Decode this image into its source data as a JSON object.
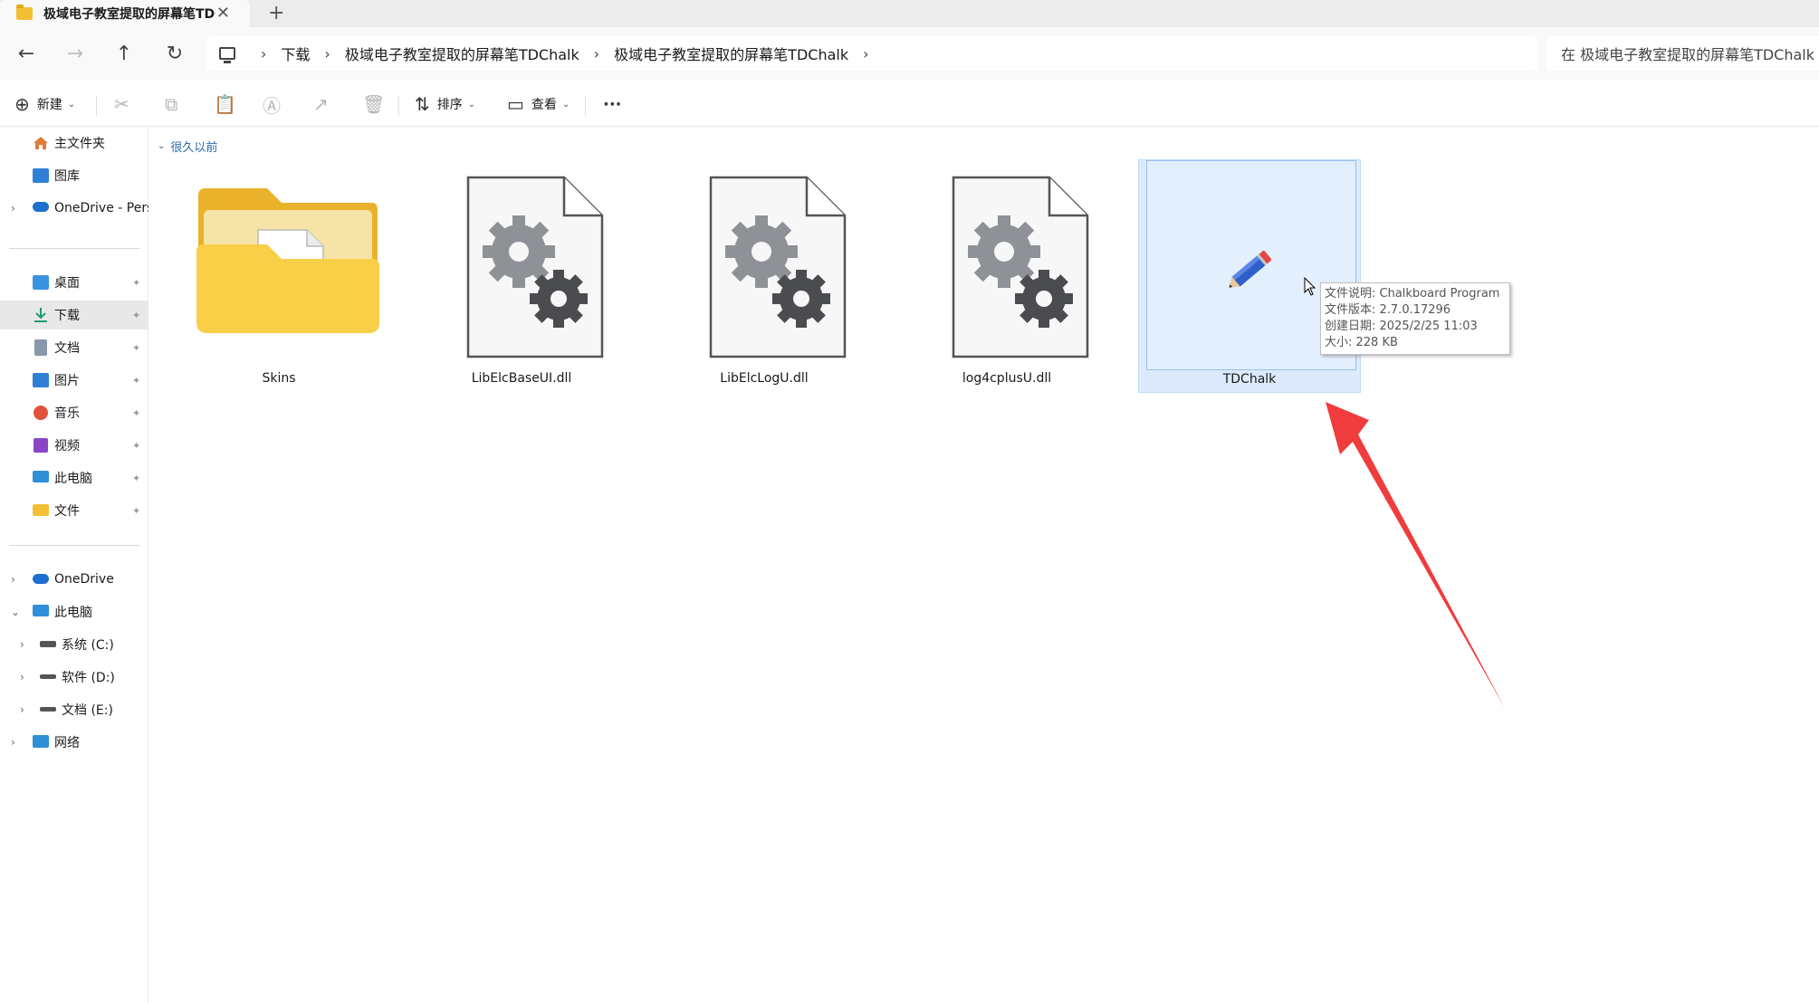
{
  "window": {
    "tab_title": "极域电子教室提取的屏幕笔TDC",
    "close_glyph": "✕",
    "new_tab_glyph": "+"
  },
  "nav": {
    "back_glyph": "←",
    "forward_glyph": "→",
    "up_glyph": "↑",
    "refresh_glyph": "↻"
  },
  "breadcrumb": {
    "separator": "›",
    "items": [
      "下载",
      "极域电子教室提取的屏幕笔TDChalk",
      "极域电子教室提取的屏幕笔TDChalk"
    ]
  },
  "search": {
    "placeholder": "在 极域电子教室提取的屏幕笔TDChalk 中搜索"
  },
  "toolbar": {
    "new_label": "新建",
    "sort_label": "排序",
    "view_label": "查看",
    "more_glyph": "···"
  },
  "sidebar": {
    "quick": [
      {
        "label": "主文件夹",
        "icon": "home-icon",
        "color": "#e07b39"
      },
      {
        "label": "图库",
        "icon": "gallery-icon",
        "color": "#2f7fd6"
      },
      {
        "label": "OneDrive - Pers",
        "icon": "cloud-icon",
        "color": "#1e6fd0"
      }
    ],
    "pinned": [
      {
        "label": "桌面",
        "icon": "desktop-icon",
        "color": "#3a93e0"
      },
      {
        "label": "下载",
        "icon": "download-icon",
        "color": "#1f9d6b"
      },
      {
        "label": "文档",
        "icon": "document-icon",
        "color": "#7a8a9c"
      },
      {
        "label": "图片",
        "icon": "picture-icon",
        "color": "#2f7fd6"
      },
      {
        "label": "音乐",
        "icon": "music-icon",
        "color": "#e0533a"
      },
      {
        "label": "视频",
        "icon": "video-icon",
        "color": "#8a45c7"
      },
      {
        "label": "此电脑",
        "icon": "computer-icon",
        "color": "#2f8fd8"
      },
      {
        "label": "文件",
        "icon": "folder-icon",
        "color": "#f3c035"
      }
    ],
    "tree": [
      {
        "label": "OneDrive",
        "icon": "cloud-icon",
        "color": "#1e6fd0"
      },
      {
        "label": "此电脑",
        "icon": "computer-icon",
        "color": "#2f8fd8"
      },
      {
        "label": "系统 (C:)",
        "icon": "drive-c-icon",
        "color": "#555555"
      },
      {
        "label": "软件 (D:)",
        "icon": "drive-icon",
        "color": "#555555"
      },
      {
        "label": "文档 (E:)",
        "icon": "drive-icon",
        "color": "#555555"
      },
      {
        "label": "网络",
        "icon": "network-icon",
        "color": "#2f8fd8"
      }
    ],
    "pin_glyph": "📌",
    "collapsed_glyph": "›",
    "expanded_glyph": "⌄"
  },
  "content": {
    "group_label": "很久以前",
    "files": [
      {
        "name": "Skins",
        "icon": "folder-icon"
      },
      {
        "name": "LibElcBaseUI.dll",
        "icon": "dll-gear-icon"
      },
      {
        "name": "LibElcLogU.dll",
        "icon": "dll-gear-icon"
      },
      {
        "name": "log4cplusU.dll",
        "icon": "dll-gear-icon"
      },
      {
        "name": "TDChalk",
        "icon": "pencil-icon"
      }
    ]
  },
  "tooltip": {
    "lines": [
      "文件说明: Chalkboard Program",
      "文件版本: 2.7.0.17296",
      "创建日期: 2025/2/25 11:03",
      "大小: 228 KB"
    ]
  },
  "colors": {
    "accent": "#2a6ab0",
    "selection": "#dceafb",
    "annotation_arrow": "#f03c3c"
  }
}
